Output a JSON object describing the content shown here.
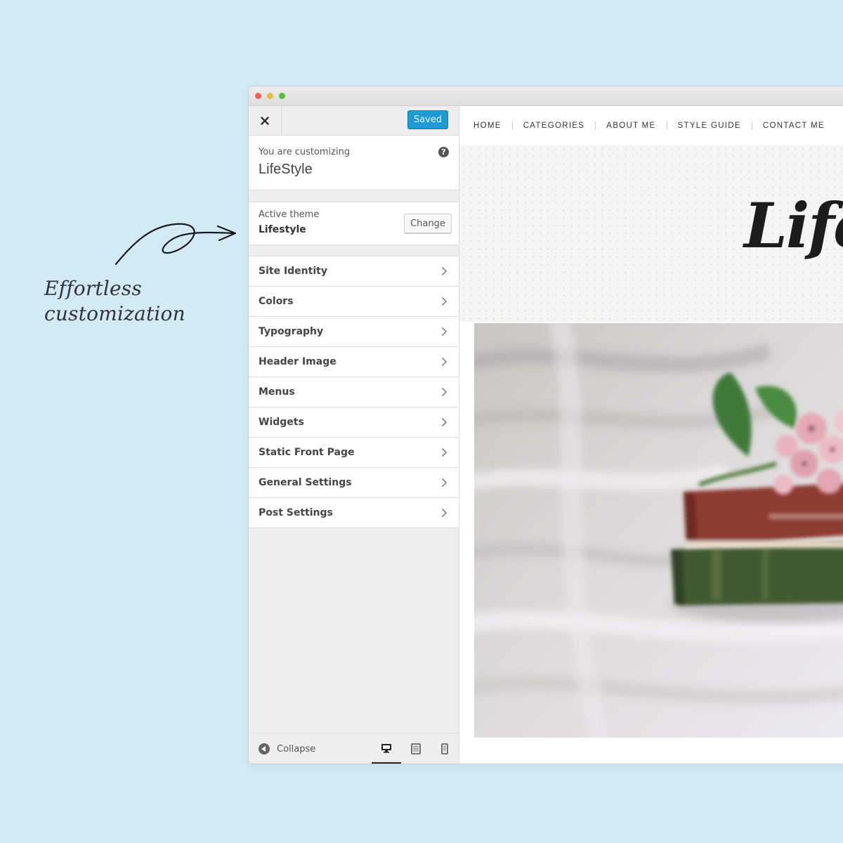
{
  "tagline": {
    "line1": "Effortless",
    "line2": "customization"
  },
  "window": {
    "controls": [
      "close",
      "minimize",
      "maximize"
    ]
  },
  "customizer": {
    "close_icon": "close-icon",
    "saved_label": "Saved",
    "customizing_label": "You are customizing",
    "site_title": "LifeStyle",
    "help_symbol": "?",
    "active_theme_label": "Active theme",
    "active_theme_name": "Lifestyle",
    "change_label": "Change",
    "sections": [
      {
        "label": "Site Identity"
      },
      {
        "label": "Colors"
      },
      {
        "label": "Typography"
      },
      {
        "label": "Header Image"
      },
      {
        "label": "Menus"
      },
      {
        "label": "Widgets"
      },
      {
        "label": "Static Front Page"
      },
      {
        "label": "General Settings"
      },
      {
        "label": "Post Settings"
      }
    ],
    "collapse_label": "Collapse",
    "devices": [
      "desktop-icon",
      "tablet-icon",
      "mobile-icon"
    ],
    "accent_color": "#1e9bd7"
  },
  "preview": {
    "nav": [
      "HOME",
      "CATEGORIES",
      "ABOUT ME",
      "STYLE GUIDE",
      "CONTACT ME"
    ],
    "logo_text": "Lifesty"
  }
}
